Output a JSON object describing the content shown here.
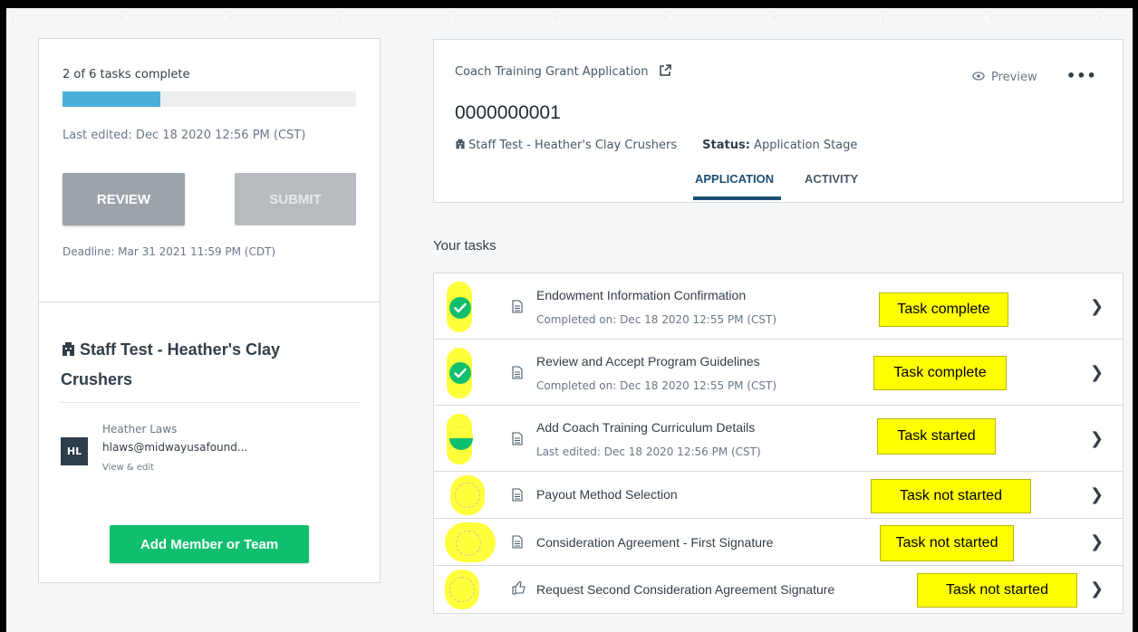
{
  "progress": {
    "text": "2 of 6 tasks complete",
    "fraction": 0.333
  },
  "left_panel": {
    "last_edited": "Last edited: Dec 18 2020 12:56 PM (CST)",
    "review_label": "REVIEW",
    "submit_label": "SUBMIT",
    "deadline": "Deadline: Mar 31 2021 11:59 PM (CDT)",
    "org_name": "Staff Test - Heather's Clay Crushers",
    "member": {
      "initials": "HL",
      "name": "Heather Laws",
      "email": "hlaws@midwayusafound...",
      "link": "View & edit"
    },
    "add_label": "Add Member or Team"
  },
  "header": {
    "app_title": "Coach Training Grant Application",
    "preview_label": "Preview",
    "more_label": "•••",
    "app_id": "0000000001",
    "org": "Staff Test - Heather's Clay Crushers",
    "status_key": "Status:",
    "status_value": "Application Stage",
    "tabs": [
      {
        "label": "APPLICATION"
      },
      {
        "label": "ACTIVITY"
      }
    ]
  },
  "tasks_heading": "Your tasks",
  "tasks": [
    {
      "title": "Endowment Information Confirmation",
      "sub": "Completed on: Dec 18 2020 12:55 PM (CST)",
      "status": "complete",
      "label": "Task complete"
    },
    {
      "title": "Review and Accept Program Guidelines",
      "sub": "Completed on: Dec 18 2020 12:55 PM (CST)",
      "status": "complete",
      "label": "Task complete"
    },
    {
      "title": "Add Coach Training Curriculum Details",
      "sub": "Last edited: Dec 18 2020 12:56 PM (CST)",
      "status": "started",
      "label": "Task started"
    },
    {
      "title": "Payout Method Selection",
      "sub": "",
      "status": "not-started",
      "label": "Task not started"
    },
    {
      "title": "Consideration Agreement - First Signature",
      "sub": "",
      "status": "not-started",
      "label": "Task not started"
    },
    {
      "title": "Request Second Consideration Agreement Signature",
      "sub": "",
      "status": "not-started",
      "label": "Task not started"
    }
  ],
  "colors": {
    "accent_green": "#0fbf6e",
    "progress_blue": "#4ab0d9",
    "tab_blue": "#1d4f76",
    "highlight_yellow": "#ffff00"
  },
  "icons": {
    "org": "building-icon",
    "external": "external-link-icon",
    "preview": "eye-icon",
    "doc": "document-icon",
    "signature": "thumbs-up-icon",
    "chevron": "chevron-right-icon",
    "check": "check-icon"
  }
}
